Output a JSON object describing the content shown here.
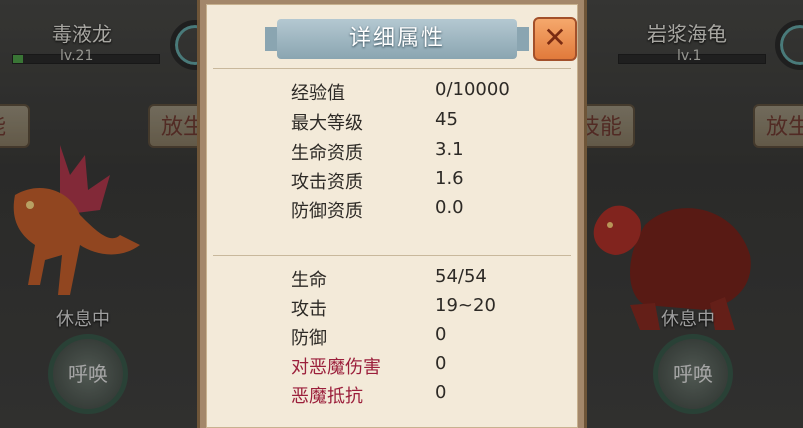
{
  "left_pet": {
    "name": "毒液龙",
    "level": "lv.21",
    "level_fill": 0.07,
    "side_button": "能",
    "release_button": "放生",
    "status": "休息中",
    "summon": "呼唤"
  },
  "right_pet": {
    "name": "岩浆海龟",
    "level": "lv.1",
    "side_button": "技能",
    "release_button": "放生",
    "status": "休息中",
    "summon": "呼唤"
  },
  "dialog": {
    "title": "详细属性",
    "close_symbol": "✕",
    "section1": [
      {
        "label": "经验值",
        "value": "0/10000"
      },
      {
        "label": "最大等级",
        "value": "45"
      },
      {
        "label": "生命资质",
        "value": "3.1"
      },
      {
        "label": "攻击资质",
        "value": "1.6"
      },
      {
        "label": "防御资质",
        "value": "0.0"
      }
    ],
    "section2": [
      {
        "label": "生命",
        "value": "54/54"
      },
      {
        "label": "攻击",
        "value": "19~20"
      },
      {
        "label": "防御",
        "value": "0"
      },
      {
        "label": "对恶魔伤害",
        "value": "0"
      },
      {
        "label": "恶魔抵抗",
        "value": "0"
      }
    ]
  },
  "colors": {
    "panel_bg": "#f3ead9",
    "title_banner": "#9fb7c2",
    "close_button": "#e8884a",
    "demon_stat_label": "#9b1f3b"
  }
}
